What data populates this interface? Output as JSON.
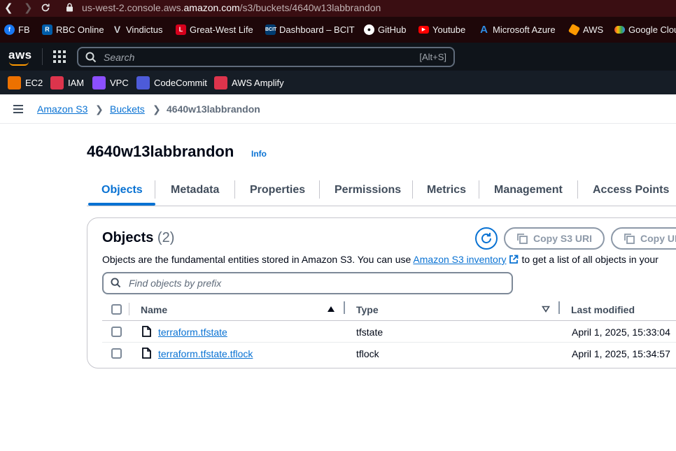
{
  "browser": {
    "url_prefix": "us-west-2.console.aws.",
    "url_domain": "amazon.com",
    "url_path": "/s3/buckets/4640w13labbrandon"
  },
  "bookmarks": [
    {
      "label": "FB",
      "icon": "facebook-icon",
      "color": "#1877f2"
    },
    {
      "label": "RBC Online",
      "icon": "rbc-icon",
      "color": "#005daa"
    },
    {
      "label": "Vindictus",
      "icon": "vindictus-icon",
      "color": "#9aa0a6"
    },
    {
      "label": "Great-West Life",
      "icon": "greatwest-icon",
      "color": "#d6001c"
    },
    {
      "label": "Dashboard – BCIT",
      "icon": "bcit-icon",
      "color": "#003c71"
    },
    {
      "label": "GitHub",
      "icon": "github-icon",
      "color": "#ffffff"
    },
    {
      "label": "Youtube",
      "icon": "youtube-icon",
      "color": "#ff0000"
    },
    {
      "label": "Microsoft Azure",
      "icon": "azure-icon",
      "color": "#0078d4"
    },
    {
      "label": "AWS",
      "icon": "aws-cube-icon",
      "color": "#ff9900"
    },
    {
      "label": "Google Clou",
      "icon": "google-cloud-icon",
      "color": "#4285f4"
    }
  ],
  "aws_nav": {
    "logo": "aws",
    "search_placeholder": "Search",
    "search_shortcut": "[Alt+S]"
  },
  "favorites": [
    {
      "label": "EC2",
      "icon": "ec2-icon",
      "color": "#ed7100"
    },
    {
      "label": "IAM",
      "icon": "iam-icon",
      "color": "#dd344c"
    },
    {
      "label": "VPC",
      "icon": "vpc-icon",
      "color": "#8c4fff"
    },
    {
      "label": "CodeCommit",
      "icon": "codecommit-icon",
      "color": "#4d5bd9"
    },
    {
      "label": "AWS Amplify",
      "icon": "amplify-icon",
      "color": "#dd344c"
    }
  ],
  "breadcrumb": {
    "items": [
      "Amazon S3",
      "Buckets"
    ],
    "current": "4640w13labbrandon"
  },
  "bucket": {
    "name": "4640w13labbrandon",
    "info_label": "Info"
  },
  "tabs": [
    "Objects",
    "Metadata",
    "Properties",
    "Permissions",
    "Metrics",
    "Management",
    "Access Points"
  ],
  "objects_panel": {
    "title": "Objects",
    "count": "(2)",
    "description_before": "Objects are the fundamental entities stored in Amazon S3. You can use",
    "description_link": "Amazon S3 inventory",
    "description_after": "to get a list of all objects in your",
    "copy_uri_label": "Copy S3 URI",
    "copy_url_label": "Copy URL",
    "filter_placeholder": "Find objects by prefix"
  },
  "table": {
    "columns": [
      "Name",
      "Type",
      "Last modified"
    ],
    "rows": [
      {
        "name": "terraform.tfstate",
        "type": "tfstate",
        "modified": "April 1, 2025, 15:33:04"
      },
      {
        "name": "terraform.tfstate.tflock",
        "type": "tflock",
        "modified": "April 1, 2025, 15:34:57"
      }
    ]
  },
  "colors": {
    "link_blue": "#0972d3",
    "nav_dark": "#0f141a",
    "aws_orange": "#ff9900"
  }
}
